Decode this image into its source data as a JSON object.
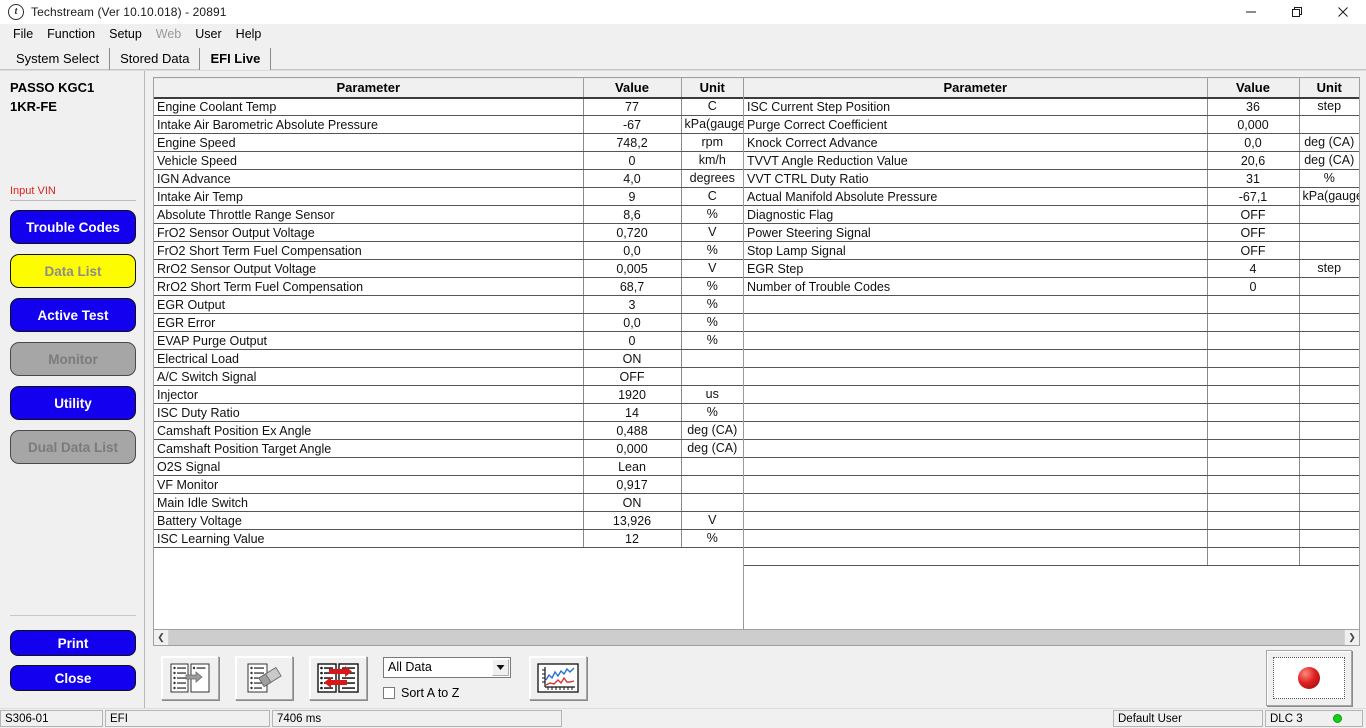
{
  "window": {
    "title": "Techstream (Ver 10.10.018) - 20891",
    "app_icon": "techstream-logo-icon",
    "minimize": "minimize-icon",
    "maximize": "maximize-icon",
    "close": "close-icon"
  },
  "menu": [
    {
      "label": "File",
      "disabled": false
    },
    {
      "label": "Function",
      "disabled": false
    },
    {
      "label": "Setup",
      "disabled": false
    },
    {
      "label": "Web",
      "disabled": true
    },
    {
      "label": "User",
      "disabled": false
    },
    {
      "label": "Help",
      "disabled": false
    }
  ],
  "tabs": [
    {
      "label": "System Select",
      "selected": false
    },
    {
      "label": "Stored Data",
      "selected": false
    },
    {
      "label": "EFI Live",
      "selected": true
    }
  ],
  "sidebar": {
    "vehicle_line1": "PASSO KGC1",
    "vehicle_line2": "1KR-FE",
    "vin_label": "Input VIN",
    "buttons": [
      {
        "label": "Trouble Codes",
        "style": "blue"
      },
      {
        "label": "Data List",
        "style": "yellow"
      },
      {
        "label": "Active Test",
        "style": "blue"
      },
      {
        "label": "Monitor",
        "style": "gray"
      },
      {
        "label": "Utility",
        "style": "blue"
      },
      {
        "label": "Dual Data List",
        "style": "gray"
      }
    ],
    "bottom_buttons": [
      {
        "label": "Print",
        "style": "blue"
      },
      {
        "label": "Close",
        "style": "blue"
      }
    ]
  },
  "table": {
    "headers": {
      "parameter": "Parameter",
      "value": "Value",
      "unit": "Unit"
    },
    "left_rows": [
      {
        "parameter": "Engine Coolant Temp",
        "value": "77",
        "unit": "C",
        "tall": false
      },
      {
        "parameter": "Intake Air Barometric Absolute Pressure",
        "value": "-67",
        "unit": "kPa(gauge)",
        "tall": true
      },
      {
        "parameter": "Engine Speed",
        "value": "748,2",
        "unit": "rpm",
        "tall": false
      },
      {
        "parameter": "Vehicle Speed",
        "value": "0",
        "unit": "km/h",
        "tall": false
      },
      {
        "parameter": "IGN Advance",
        "value": "4,0",
        "unit": "degrees",
        "tall": false
      },
      {
        "parameter": "Intake Air Temp",
        "value": "9",
        "unit": "C",
        "tall": false
      },
      {
        "parameter": "Absolute Throttle Range Sensor",
        "value": "8,6",
        "unit": "%",
        "tall": false
      },
      {
        "parameter": "FrO2 Sensor Output Voltage",
        "value": "0,720",
        "unit": "V",
        "tall": false
      },
      {
        "parameter": "FrO2 Short Term Fuel Compensation",
        "value": "0,0",
        "unit": "%",
        "tall": false
      },
      {
        "parameter": "RrO2 Sensor Output Voltage",
        "value": "0,005",
        "unit": "V",
        "tall": false
      },
      {
        "parameter": "RrO2 Short Term Fuel Compensation",
        "value": "68,7",
        "unit": "%",
        "tall": false
      },
      {
        "parameter": "EGR Output",
        "value": "3",
        "unit": "%",
        "tall": false
      },
      {
        "parameter": "EGR Error",
        "value": "0,0",
        "unit": "%",
        "tall": false
      },
      {
        "parameter": "EVAP Purge Output",
        "value": "0",
        "unit": "%",
        "tall": false
      },
      {
        "parameter": "Electrical Load",
        "value": "ON",
        "unit": "",
        "tall": false
      },
      {
        "parameter": "A/C Switch Signal",
        "value": "OFF",
        "unit": "",
        "tall": false
      },
      {
        "parameter": "Injector",
        "value": "1920",
        "unit": "us",
        "tall": false
      },
      {
        "parameter": "ISC Duty Ratio",
        "value": "14",
        "unit": "%",
        "tall": false
      },
      {
        "parameter": "Camshaft Position Ex Angle",
        "value": "0,488",
        "unit": "deg (CA)",
        "tall": true
      },
      {
        "parameter": "Camshaft Position Target Angle",
        "value": "0,000",
        "unit": "deg (CA)",
        "tall": true
      },
      {
        "parameter": "O2S Signal",
        "value": "Lean",
        "unit": "",
        "tall": false
      },
      {
        "parameter": "VF Monitor",
        "value": "0,917",
        "unit": "",
        "tall": false
      },
      {
        "parameter": "Main Idle Switch",
        "value": "ON",
        "unit": "",
        "tall": false
      },
      {
        "parameter": "Battery Voltage",
        "value": "13,926",
        "unit": "V",
        "tall": false
      },
      {
        "parameter": "ISC Learning Value",
        "value": "12",
        "unit": "%",
        "tall": false
      }
    ],
    "right_rows": [
      {
        "parameter": "ISC Current Step Position",
        "value": "36",
        "unit": "step",
        "tall": false
      },
      {
        "parameter": "Purge Correct Coefficient",
        "value": "0,000",
        "unit": "",
        "tall": false
      },
      {
        "parameter": "Knock Correct Advance",
        "value": "0,0",
        "unit": "deg (CA)",
        "tall": true
      },
      {
        "parameter": "TVVT Angle Reduction Value",
        "value": "20,6",
        "unit": "deg (CA)",
        "tall": true
      },
      {
        "parameter": "VVT CTRL Duty Ratio",
        "value": "31",
        "unit": "%",
        "tall": false
      },
      {
        "parameter": "Actual Manifold Absolute Pressure",
        "value": "-67,1",
        "unit": "kPa(gauge)",
        "tall": true
      },
      {
        "parameter": "Diagnostic Flag",
        "value": "OFF",
        "unit": "",
        "tall": false
      },
      {
        "parameter": "Power Steering Signal",
        "value": "OFF",
        "unit": "",
        "tall": false
      },
      {
        "parameter": "Stop Lamp Signal",
        "value": "OFF",
        "unit": "",
        "tall": false
      },
      {
        "parameter": "EGR Step",
        "value": "4",
        "unit": "step",
        "tall": false
      },
      {
        "parameter": "Number of Trouble Codes",
        "value": "0",
        "unit": "",
        "tall": false
      },
      {
        "parameter": "",
        "value": "",
        "unit": "",
        "tall": false
      },
      {
        "parameter": "",
        "value": "",
        "unit": "",
        "tall": false
      },
      {
        "parameter": "",
        "value": "",
        "unit": "",
        "tall": false
      },
      {
        "parameter": "",
        "value": "",
        "unit": "",
        "tall": false
      },
      {
        "parameter": "",
        "value": "",
        "unit": "",
        "tall": false
      },
      {
        "parameter": "",
        "value": "",
        "unit": "",
        "tall": false
      },
      {
        "parameter": "",
        "value": "",
        "unit": "",
        "tall": false
      },
      {
        "parameter": "",
        "value": "",
        "unit": "",
        "tall": false
      },
      {
        "parameter": "",
        "value": "",
        "unit": "",
        "tall": false
      },
      {
        "parameter": "",
        "value": "",
        "unit": "",
        "tall": false
      },
      {
        "parameter": "",
        "value": "",
        "unit": "",
        "tall": false
      },
      {
        "parameter": "",
        "value": "",
        "unit": "",
        "tall": false
      },
      {
        "parameter": "",
        "value": "",
        "unit": "",
        "tall": false
      },
      {
        "parameter": "",
        "value": "",
        "unit": "",
        "tall": false
      },
      {
        "parameter": "",
        "value": "",
        "unit": "",
        "tall": false
      }
    ]
  },
  "toolbar": {
    "select_items_icon": "select-parameters-icon",
    "clear_icon": "erase-parameters-icon",
    "swap_icon": "swap-columns-icon",
    "graph_icon": "graph-view-icon",
    "record_icon": "record-button-icon",
    "filter_value": "All Data",
    "dropdown_arrow": "chevron-down-icon",
    "sort_label": "Sort A to Z",
    "sort_checked": false
  },
  "statusbar": {
    "code": "S306-01",
    "system": "EFI",
    "timing": "7406 ms",
    "user": "Default User",
    "connection": "DLC 3",
    "led": "#12d012"
  }
}
